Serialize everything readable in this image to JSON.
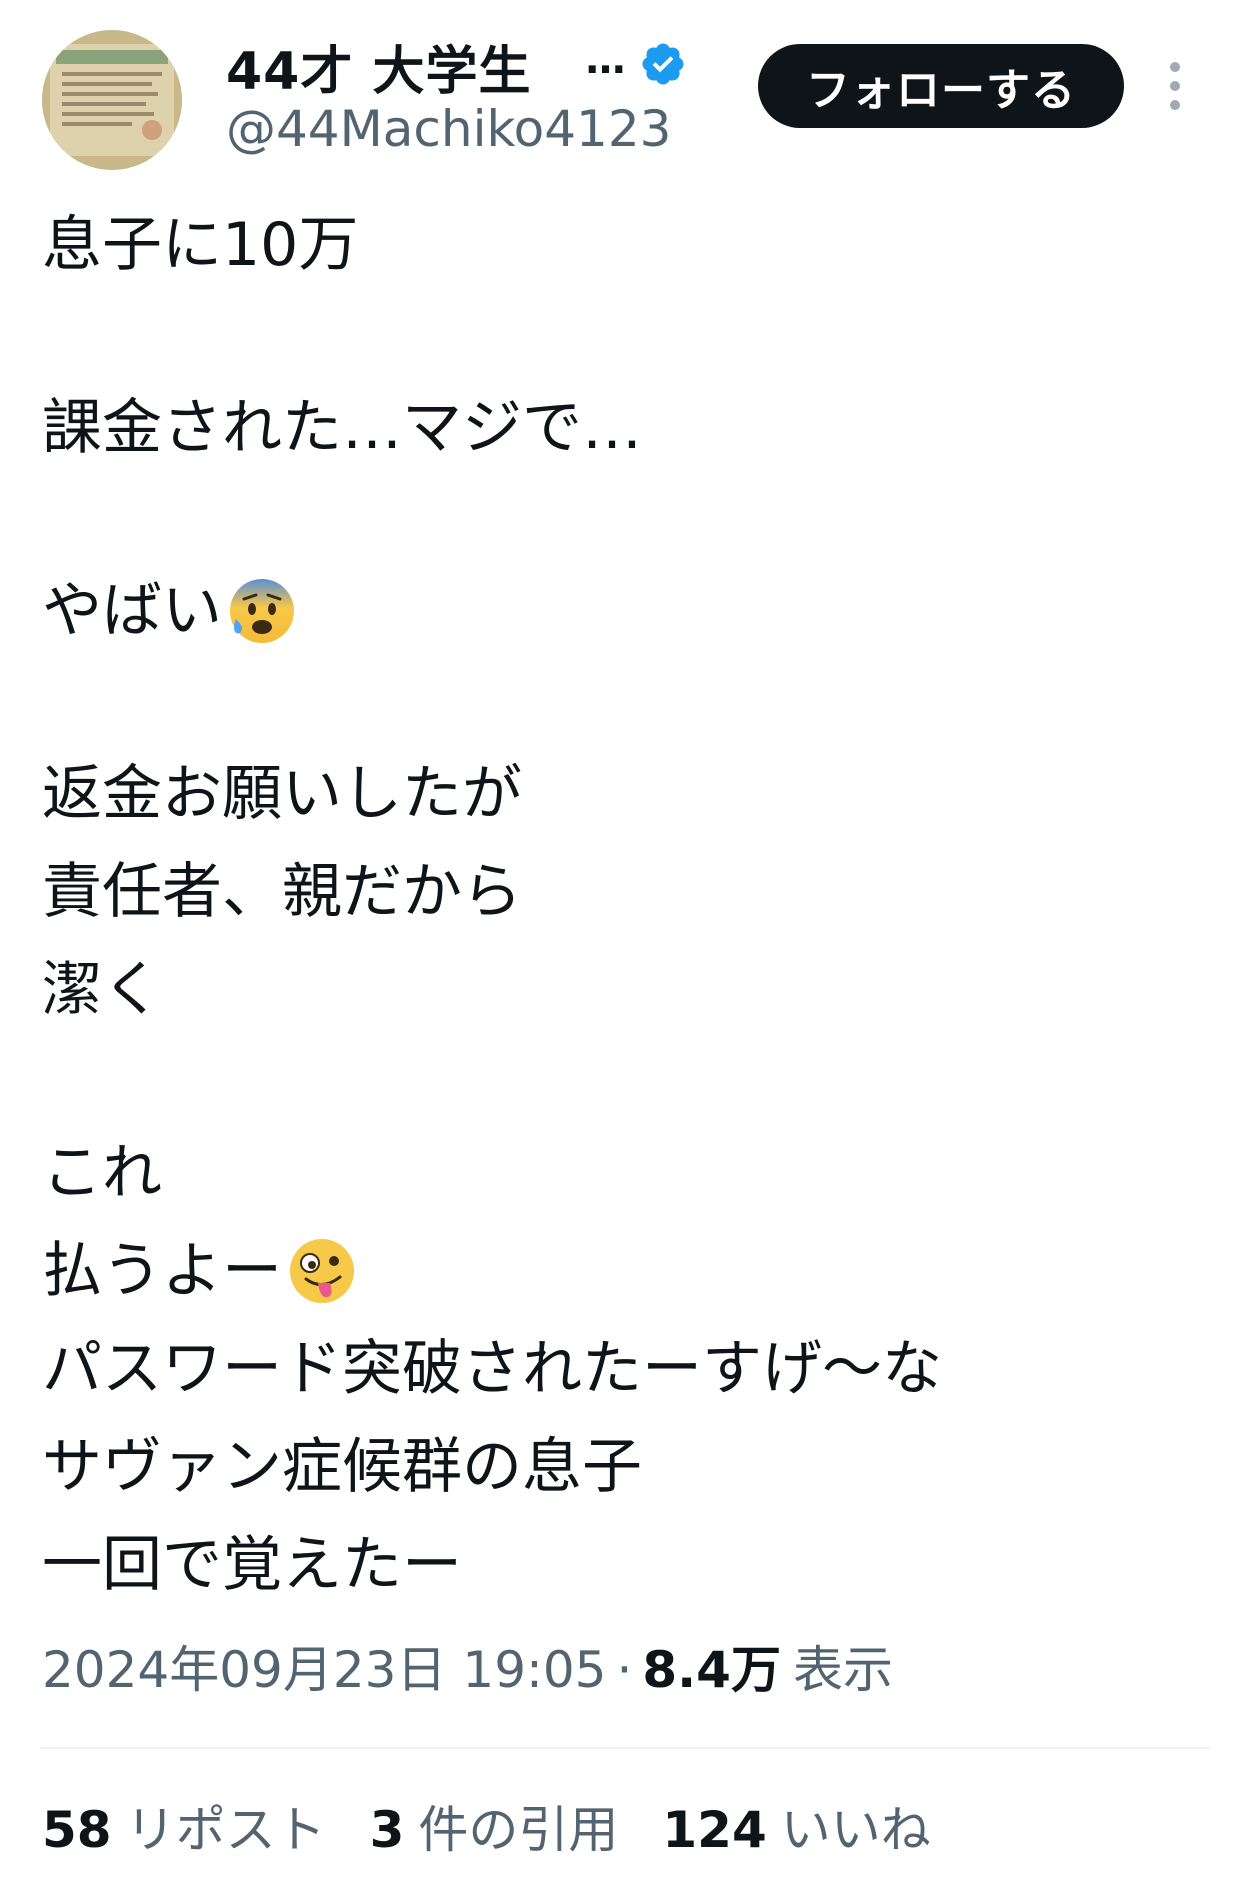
{
  "header": {
    "display_name": "44才 大学生",
    "name_ellipsis": "…",
    "handle": "@44Machiko4123",
    "follow_label": "フォローする",
    "verified_icon": "verified-badge-icon",
    "more_icon": "vertical-ellipsis-icon",
    "accent_color": "#1d9bf0"
  },
  "tweet": {
    "lines": [
      "息子に10万",
      "",
      "課金された…マジで…",
      "",
      "やばい",
      "",
      "返金お願いしたが",
      "責任者、親だから",
      "潔く",
      "",
      "これ",
      "払うよー",
      "パスワード突破されたーすげ〜な",
      "サヴァン症候群の息子",
      "一回で覚えたー"
    ],
    "emoji_anxious": "anxious-face-with-sweat-icon",
    "emoji_zany": "zany-face-icon"
  },
  "meta": {
    "timestamp": "2024年09月23日 19:05",
    "separator": "·",
    "views_count": "8.4万",
    "views_label": "表示"
  },
  "stats": {
    "reposts_count": "58",
    "reposts_label": "リポスト",
    "quotes_count": "3",
    "quotes_label": "件の引用",
    "likes_count": "124",
    "likes_label": "いいね"
  }
}
